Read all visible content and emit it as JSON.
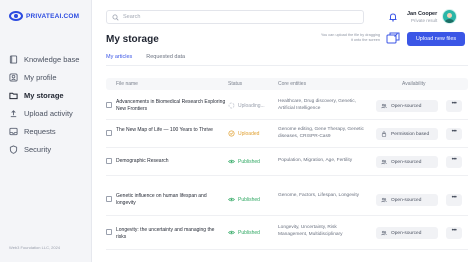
{
  "brand": {
    "name": "PRIVATEAI.COM"
  },
  "sidebar": {
    "items": [
      {
        "label": "Knowledge base",
        "icon": "book-icon"
      },
      {
        "label": "My profile",
        "icon": "user-icon"
      },
      {
        "label": "My storage",
        "icon": "folder-icon",
        "active": true
      },
      {
        "label": "Upload activity",
        "icon": "upload-icon"
      },
      {
        "label": "Requests",
        "icon": "inbox-icon"
      },
      {
        "label": "Security",
        "icon": "shield-icon"
      }
    ],
    "footer": "Web3 Foundation LLC, 2024"
  },
  "header": {
    "search_placeholder": "Search",
    "user_name": "Jan Cooper",
    "user_role": "Private result"
  },
  "main": {
    "title": "My storage",
    "upload_hint": "You can upload the file by dragging it onto the screen",
    "upload_button": "Upload new files",
    "tabs": [
      {
        "label": "My articles",
        "active": true
      },
      {
        "label": "Requested data",
        "active": false
      }
    ]
  },
  "table": {
    "headers": {
      "file": "File name",
      "status": "Status",
      "entities": "Core entities",
      "availability": "Availability"
    },
    "rows": [
      {
        "name": "Advancements in Biomedical Research Exploring New Frontiers",
        "status": "Uploading...",
        "status_kind": "uploading",
        "entities": "Healthcare, Drug discovery, Genetic, Artificial Intelligence",
        "availability": "Open-sourced"
      },
      {
        "name": "The New Map of Life — 100 Years to Thrive",
        "status": "Uploaded",
        "status_kind": "uploaded",
        "entities": "Genome editing, Gene Therapy, Genetic diseases, CRISPR-Cas9",
        "availability": "Permission based"
      },
      {
        "name": "Demographic Research",
        "status": "Published",
        "status_kind": "published",
        "entities": "Population, Migration, Age, Fertility",
        "availability": "Open-sourced"
      },
      {
        "name": "Genetic influence on human lifespan and longevity",
        "status": "Published",
        "status_kind": "published",
        "entities": "Genome, Factors, Lifespan, Longevity",
        "availability": "Open-sourced"
      },
      {
        "name": "Longevity: the uncertainty and managing the risks",
        "status": "Published",
        "status_kind": "published",
        "entities": "Longevity, Uncertainty, Risk Management, Multidisciplinary",
        "availability": "Open-sourced"
      }
    ]
  },
  "colors": {
    "accent": "#3b56e6",
    "uploading": "#9aa0ad",
    "uploaded": "#e0a030",
    "published": "#2fa863"
  }
}
